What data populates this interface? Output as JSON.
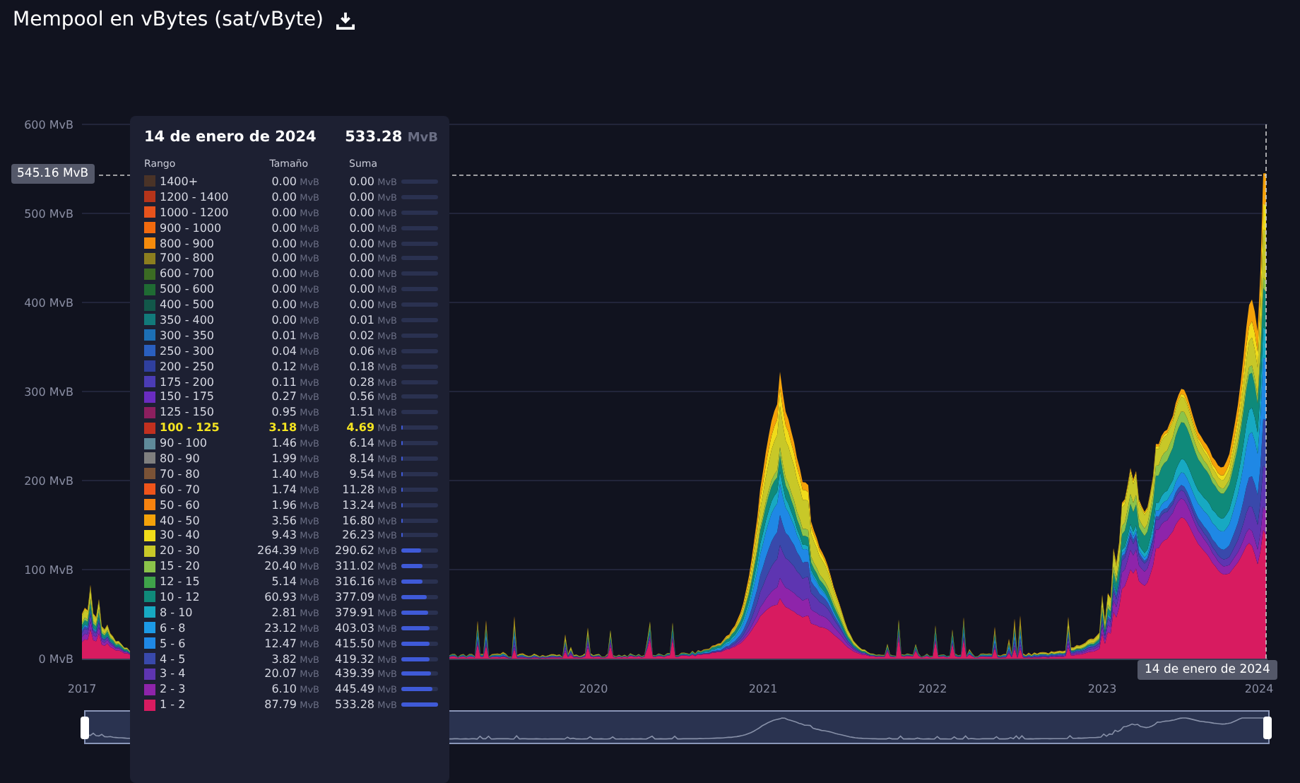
{
  "title": "Mempool en vBytes (sat/vByte)",
  "chart": {
    "yticks": [
      "600 MvB",
      "500 MvB",
      "400 MvB",
      "300 MvB",
      "200 MvB",
      "100 MvB",
      "0 MvB"
    ],
    "xticks": [
      "2017",
      "2020",
      "2021",
      "2022",
      "2023",
      "2024"
    ],
    "cursor_value": "545.16 MvB",
    "cursor_date": "14 de enero de 2024"
  },
  "tooltip": {
    "date": "14 de enero de 2024",
    "total": "533.28",
    "total_unit": "MvB",
    "columns": [
      "Rango",
      "Tamaño",
      "Suma"
    ],
    "rows": [
      {
        "range": "1400+",
        "size": "0.00 MvB",
        "sum": "0.00 MvB",
        "color": "#4a3327",
        "selected": false
      },
      {
        "range": "1200 - 1400",
        "size": "0.00 MvB",
        "sum": "0.00 MvB",
        "color": "#b5341a",
        "selected": false
      },
      {
        "range": "1000 - 1200",
        "size": "0.00 MvB",
        "sum": "0.00 MvB",
        "color": "#e8531c",
        "selected": false
      },
      {
        "range": "900 - 1000",
        "size": "0.00 MvB",
        "sum": "0.00 MvB",
        "color": "#f26a0e",
        "selected": false
      },
      {
        "range": "800 - 900",
        "size": "0.00 MvB",
        "sum": "0.00 MvB",
        "color": "#f58b0c",
        "selected": false
      },
      {
        "range": "700 - 800",
        "size": "0.00 MvB",
        "sum": "0.00 MvB",
        "color": "#8c7e1f",
        "selected": false
      },
      {
        "range": "600 - 700",
        "size": "0.00 MvB",
        "sum": "0.00 MvB",
        "color": "#3b6b23",
        "selected": false
      },
      {
        "range": "500 - 600",
        "size": "0.00 MvB",
        "sum": "0.00 MvB",
        "color": "#1f6b33",
        "selected": false
      },
      {
        "range": "400 - 500",
        "size": "0.00 MvB",
        "sum": "0.00 MvB",
        "color": "#12584a",
        "selected": false
      },
      {
        "range": "350 - 400",
        "size": "0.00 MvB",
        "sum": "0.01 MvB",
        "color": "#127a7a",
        "selected": false
      },
      {
        "range": "300 - 350",
        "size": "0.01 MvB",
        "sum": "0.02 MvB",
        "color": "#1c6fb5",
        "selected": false
      },
      {
        "range": "250 - 300",
        "size": "0.04 MvB",
        "sum": "0.06 MvB",
        "color": "#2a5fbf",
        "selected": false
      },
      {
        "range": "200 - 250",
        "size": "0.12 MvB",
        "sum": "0.18 MvB",
        "color": "#2f3f9e",
        "selected": false
      },
      {
        "range": "175 - 200",
        "size": "0.11 MvB",
        "sum": "0.28 MvB",
        "color": "#4b3cb5",
        "selected": false
      },
      {
        "range": "150 - 175",
        "size": "0.27 MvB",
        "sum": "0.56 MvB",
        "color": "#6a2cc0",
        "selected": false
      },
      {
        "range": "125 - 150",
        "size": "0.95 MvB",
        "sum": "1.51 MvB",
        "level": 0.003,
        "color": "#8c1f5f",
        "selected": false
      },
      {
        "range": "100 - 125",
        "size": "3.18 MvB",
        "sum": "4.69 MvB",
        "level": 0.009,
        "color": "#c2301f",
        "selected": true
      },
      {
        "range": "90 - 100",
        "size": "1.46 MvB",
        "sum": "6.14 MvB",
        "level": 0.012,
        "color": "#5f8a9a",
        "selected": false
      },
      {
        "range": "80 - 90",
        "size": "1.99 MvB",
        "sum": "8.14 MvB",
        "level": 0.015,
        "color": "#7f7f7f",
        "selected": false
      },
      {
        "range": "70 - 80",
        "size": "1.40 MvB",
        "sum": "9.54 MvB",
        "level": 0.018,
        "color": "#7a5236",
        "selected": false
      },
      {
        "range": "60 - 70",
        "size": "1.74 MvB",
        "sum": "11.28 MvB",
        "level": 0.021,
        "color": "#f0541a",
        "selected": false
      },
      {
        "range": "50 - 60",
        "size": "1.96 MvB",
        "sum": "13.24 MvB",
        "level": 0.025,
        "color": "#f7820f",
        "selected": false
      },
      {
        "range": "40 - 50",
        "size": "3.56 MvB",
        "sum": "16.80 MvB",
        "level": 0.032,
        "color": "#f5a20a",
        "selected": false
      },
      {
        "range": "30 - 40",
        "size": "9.43 MvB",
        "sum": "26.23 MvB",
        "level": 0.049,
        "color": "#f0dc1a",
        "selected": false
      },
      {
        "range": "20 - 30",
        "size": "264.39 MvB",
        "sum": "290.62 MvB",
        "level": 0.545,
        "color": "#c8c828",
        "selected": false
      },
      {
        "range": "15 - 20",
        "size": "20.40 MvB",
        "sum": "311.02 MvB",
        "level": 0.583,
        "color": "#8bc34a",
        "selected": false
      },
      {
        "range": "12 - 15",
        "size": "5.14 MvB",
        "sum": "316.16 MvB",
        "level": 0.593,
        "color": "#3fa34a",
        "selected": false
      },
      {
        "range": "10 - 12",
        "size": "60.93 MvB",
        "sum": "377.09 MvB",
        "level": 0.707,
        "color": "#0f8a7a",
        "selected": false
      },
      {
        "range": "8 - 10",
        "size": "2.81 MvB",
        "sum": "379.91 MvB",
        "level": 0.712,
        "color": "#17a9c2",
        "selected": false
      },
      {
        "range": "6 - 8",
        "size": "23.12 MvB",
        "sum": "403.03 MvB",
        "level": 0.756,
        "color": "#1c9ae6",
        "selected": false
      },
      {
        "range": "5 - 6",
        "size": "12.47 MvB",
        "sum": "415.50 MvB",
        "level": 0.779,
        "color": "#1f88e5",
        "selected": false
      },
      {
        "range": "4 - 5",
        "size": "3.82 MvB",
        "sum": "419.32 MvB",
        "level": 0.786,
        "color": "#3949ab",
        "selected": false
      },
      {
        "range": "3 - 4",
        "size": "20.07 MvB",
        "sum": "439.39 MvB",
        "level": 0.824,
        "color": "#5e35b1",
        "selected": false
      },
      {
        "range": "2 - 3",
        "size": "6.10 MvB",
        "sum": "445.49 MvB",
        "level": 0.835,
        "color": "#8e24aa",
        "selected": false
      },
      {
        "range": "1 - 2",
        "size": "87.79 MvB",
        "sum": "533.28 MvB",
        "level": 1,
        "color": "#d81b60",
        "selected": false
      }
    ]
  }
}
